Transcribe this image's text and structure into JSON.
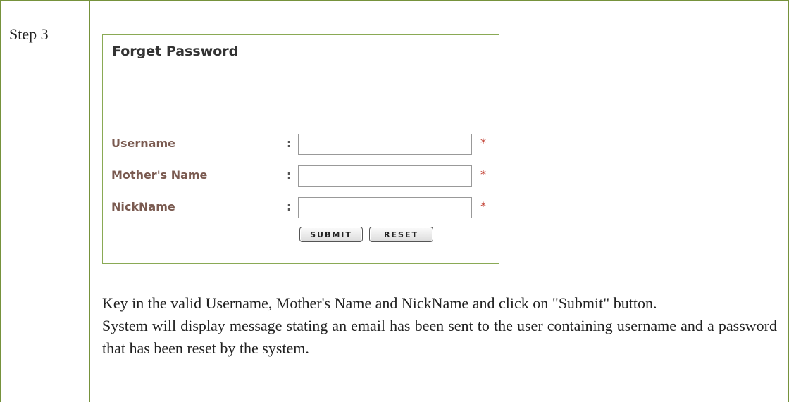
{
  "step": {
    "label": "Step 3"
  },
  "form": {
    "title": "Forget Password",
    "fields": [
      {
        "label": "Username",
        "separator": ":",
        "value": "",
        "required_mark": "*"
      },
      {
        "label": "Mother's Name",
        "separator": ":",
        "value": "",
        "required_mark": "*"
      },
      {
        "label": "NickName",
        "separator": ":",
        "value": "",
        "required_mark": "*"
      }
    ],
    "buttons": {
      "submit": "SUBMIT",
      "reset": "RESET"
    }
  },
  "instructions": [
    "Key in the valid Username, Mother's Name and NickName and click on \"Submit\" button.",
    "System will display message stating an email has been sent to the user containing username and a password that has been reset by the system."
  ],
  "colors": {
    "table_border": "#76923c",
    "panel_border": "#8aaa55",
    "label_text": "#7a5a50",
    "required_mark": "#c0392b"
  }
}
